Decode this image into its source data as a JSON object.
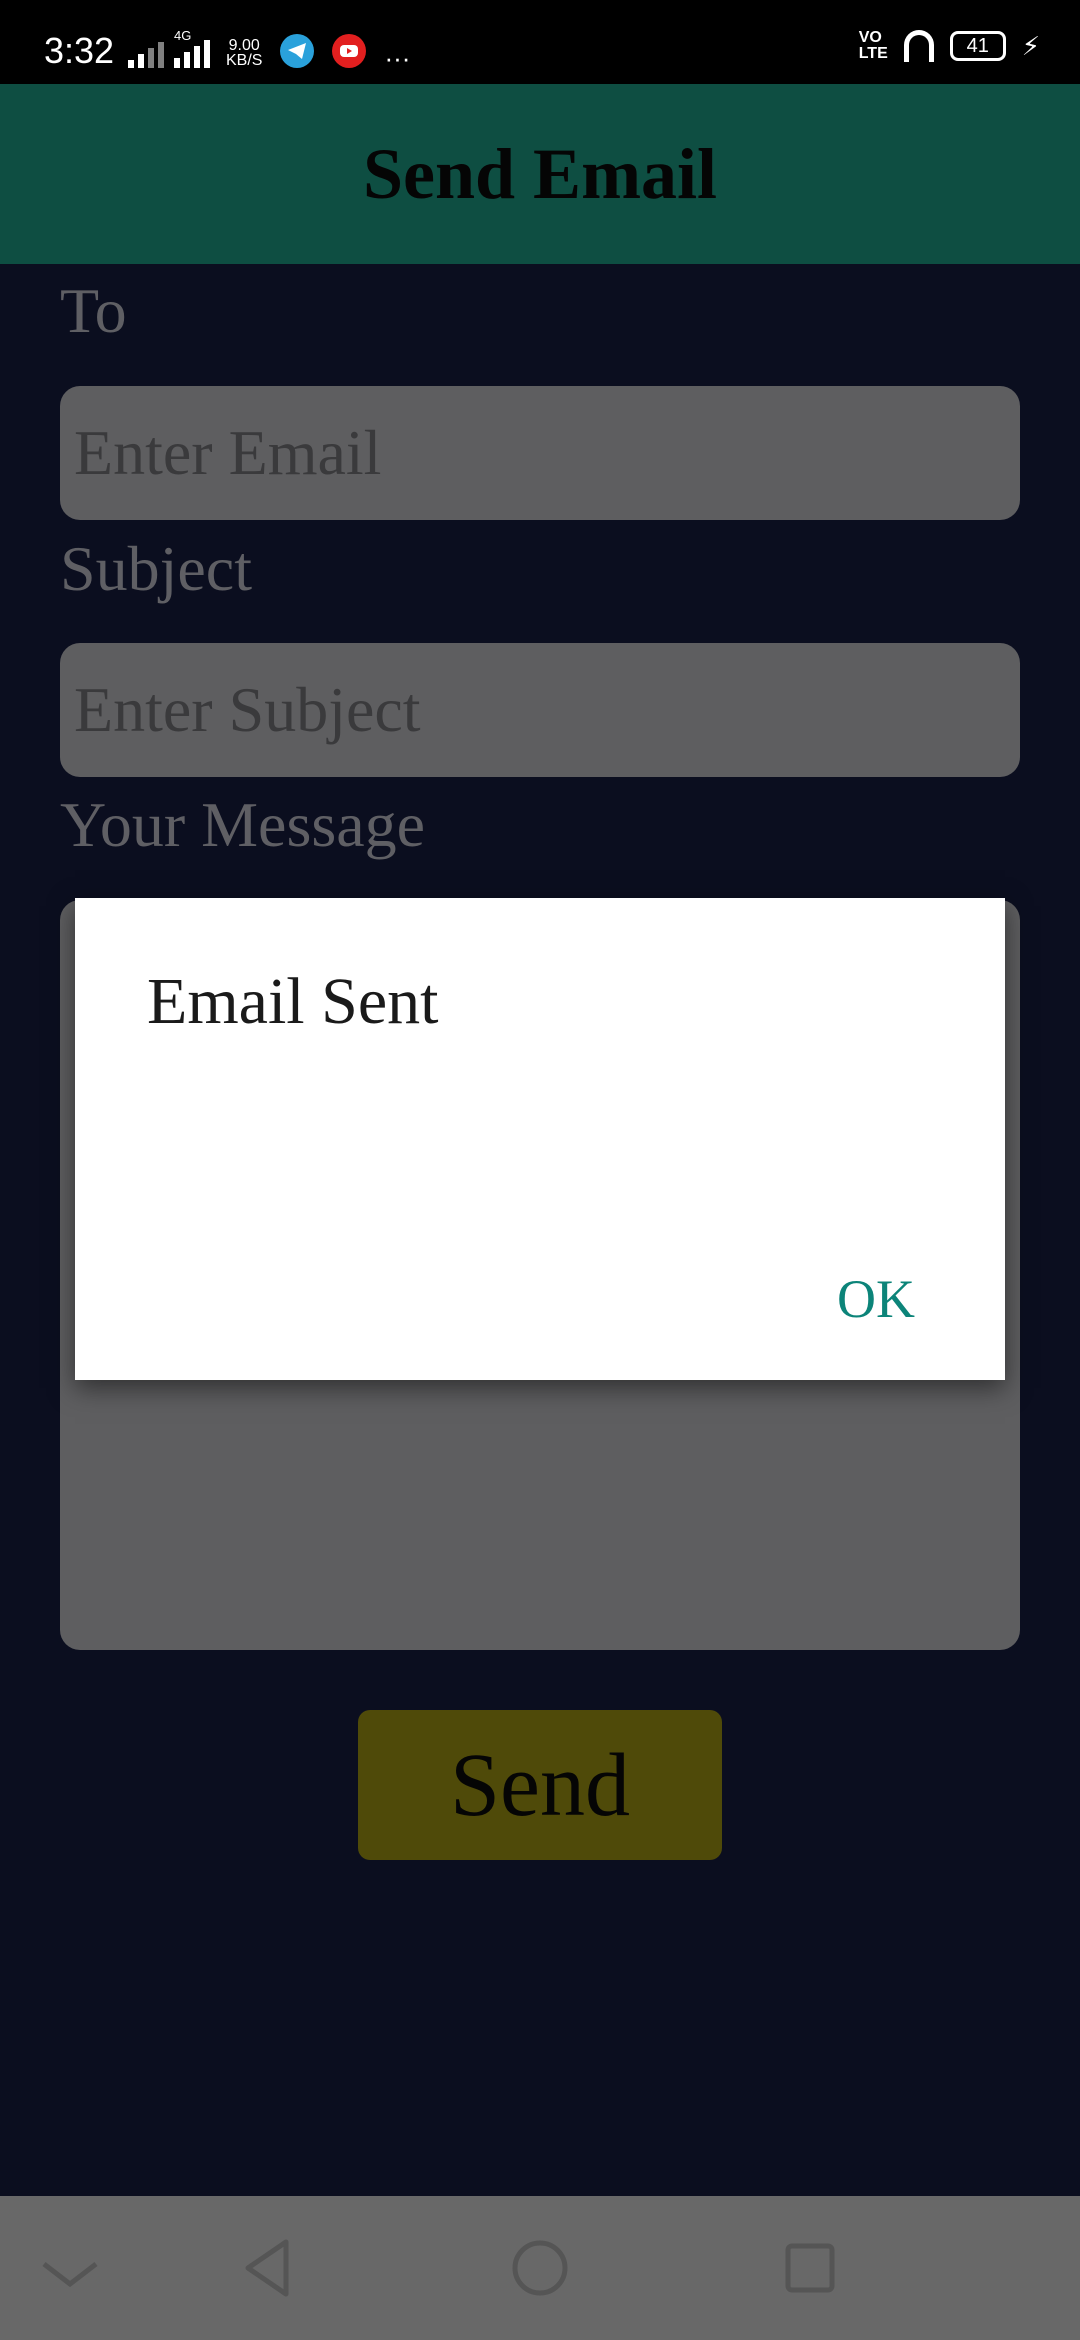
{
  "status_bar": {
    "time": "3:32",
    "network_type": "4G",
    "net_speed_value": "9.00",
    "net_speed_unit": "KB/S",
    "more": "···",
    "volte_top": "VO",
    "volte_bottom": "LTE",
    "battery": "41",
    "icons": [
      "signal-icon",
      "telegram-icon",
      "youtube-icon",
      "headset-icon",
      "battery-icon",
      "charging-icon"
    ]
  },
  "app_bar": {
    "title": "Send Email",
    "color": "#0e4e42"
  },
  "form": {
    "to_label": "To",
    "to_placeholder": "Enter Email",
    "subject_label": "Subject",
    "subject_placeholder": "Enter Subject",
    "message_label": "Your Message",
    "send_label": "Send",
    "send_color": "#4f4a09"
  },
  "dialog": {
    "title": "Email Sent",
    "ok_label": "OK",
    "ok_color": "#0c8479"
  },
  "nav_bar": {
    "icons": [
      "chevron-down-icon",
      "back-icon",
      "home-icon",
      "recents-icon"
    ]
  }
}
